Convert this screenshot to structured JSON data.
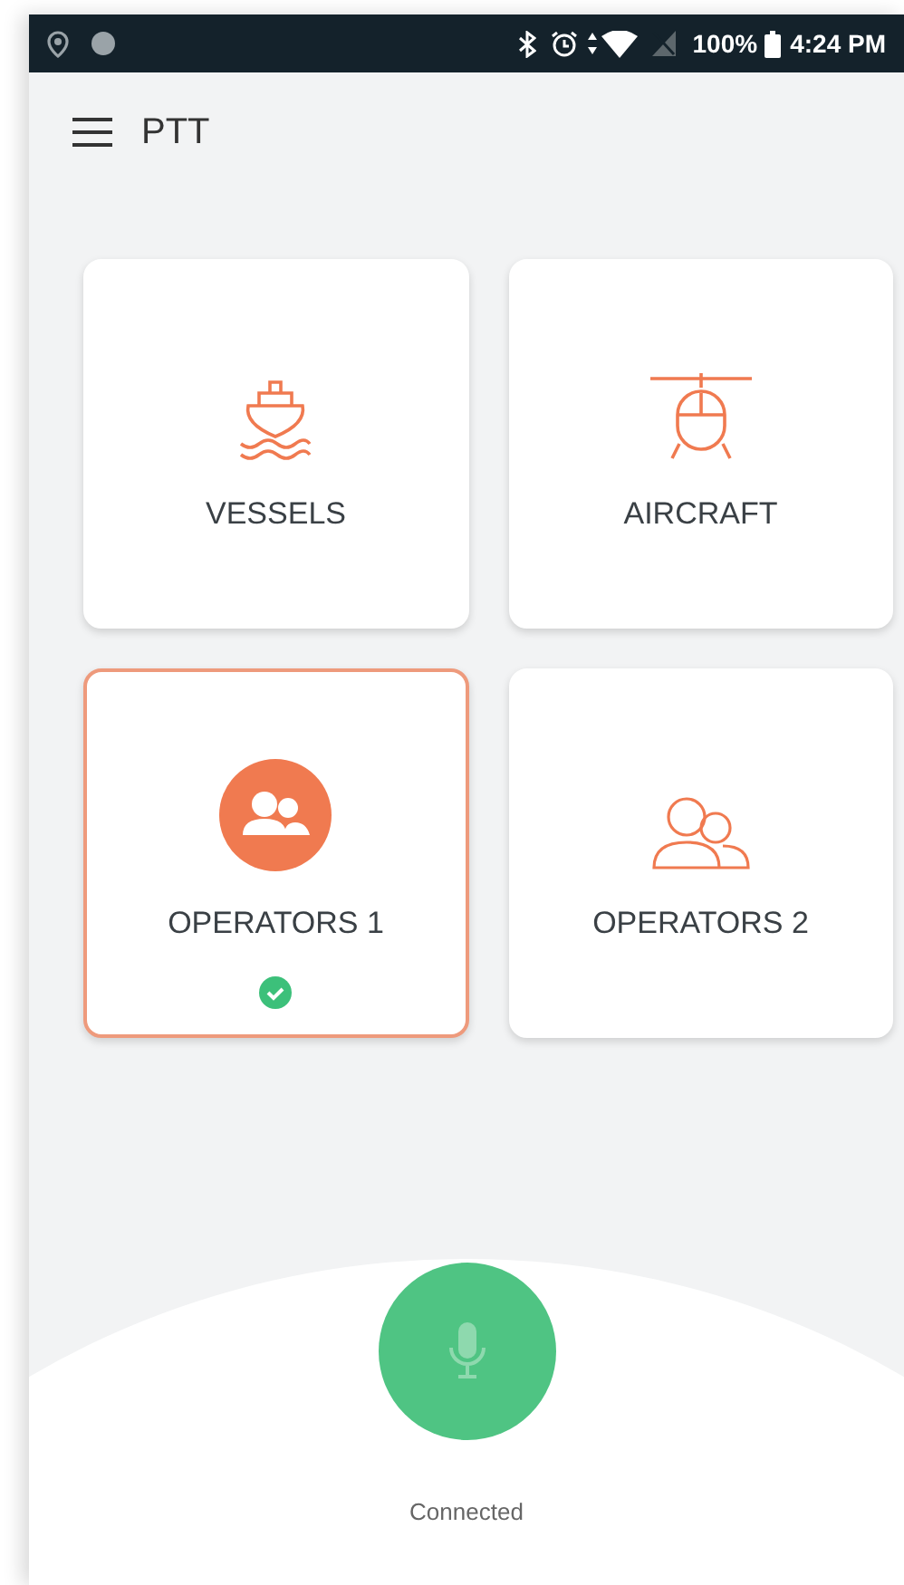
{
  "status_bar": {
    "battery": "100%",
    "time": "4:24 PM"
  },
  "app_bar": {
    "title": "PTT"
  },
  "groups": [
    {
      "kind": "vessel",
      "label": "VESSELS",
      "selected": false
    },
    {
      "kind": "aircraft",
      "label": "AIRCRAFT",
      "selected": false
    },
    {
      "kind": "operators",
      "label": "OPERATORS 1",
      "selected": true
    },
    {
      "kind": "operators",
      "label": "OPERATORS 2",
      "selected": false
    }
  ],
  "ptt": {
    "status": "Connected"
  }
}
